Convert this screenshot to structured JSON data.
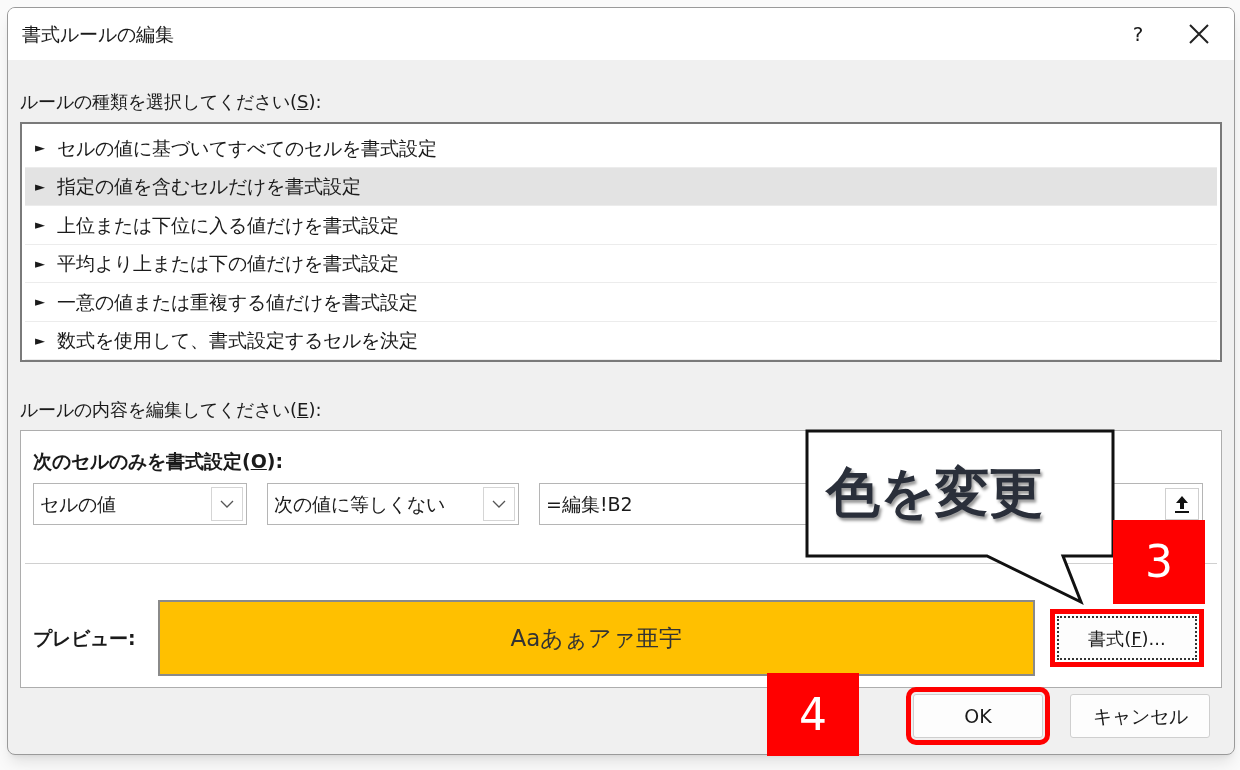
{
  "window": {
    "title": "書式ルールの編集",
    "help": "?"
  },
  "rule_types": {
    "label": {
      "before": "ルールの種類を選択してください(",
      "key": "S",
      "after": "):"
    },
    "items": [
      {
        "marker": "►",
        "text": "セルの値に基づいてすべてのセルを書式設定",
        "selected": false
      },
      {
        "marker": "►",
        "text": "指定の値を含むセルだけを書式設定",
        "selected": true
      },
      {
        "marker": "►",
        "text": "上位または下位に入る値だけを書式設定",
        "selected": false
      },
      {
        "marker": "►",
        "text": "平均より上または下の値だけを書式設定",
        "selected": false
      },
      {
        "marker": "►",
        "text": "一意の値または重複する値だけを書式設定",
        "selected": false
      },
      {
        "marker": "►",
        "text": "数式を使用して、書式設定するセルを決定",
        "selected": false
      }
    ]
  },
  "rule_description": {
    "label": {
      "before": "ルールの内容を編集してください(",
      "key": "E",
      "after": "):"
    },
    "condition_label": {
      "before": "次のセルのみを書式設定(",
      "key": "O",
      "after": "):"
    },
    "dropdowns": [
      {
        "value": "セルの値"
      },
      {
        "value": "次の値に等しくない"
      }
    ],
    "formula_field": {
      "value": "=編集!B2"
    },
    "preview_label": "プレビュー:",
    "preview": {
      "sample": "Aaあぁアァ亜宇"
    },
    "format_button": {
      "label": {
        "before": "書式(",
        "key": "F",
        "after": ")..."
      },
      "highlighted": true
    }
  },
  "buttons": [
    {
      "label": "OK",
      "highlighted": true
    },
    {
      "label": "キャンセル",
      "highlighted": false
    }
  ],
  "annotations": {
    "callout": "色を変更",
    "steps": [
      {
        "number": "3"
      },
      {
        "number": "4"
      }
    ]
  }
}
